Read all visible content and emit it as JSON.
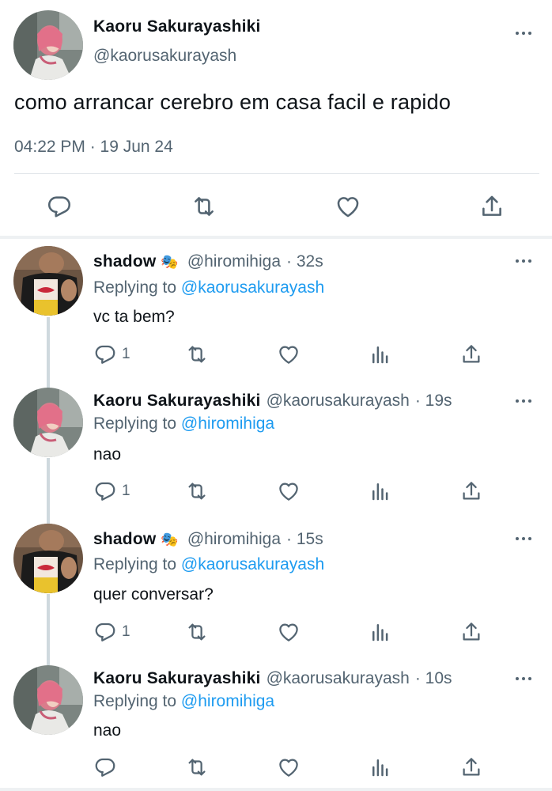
{
  "main_tweet": {
    "author_name": "Kaoru Sakurayashiki",
    "author_handle": "@kaorusakurayash",
    "text": "como arrancar cerebro em casa facil e rapido",
    "timestamp": "04:22 PM · 19 Jun 24",
    "actions": [
      "reply-icon",
      "retweet-icon",
      "like-icon",
      "share-icon"
    ]
  },
  "replies": [
    {
      "name": "shadow",
      "badge": "🎭",
      "handle": "@hiromihiga",
      "time": "· 32s",
      "replying_prefix": "Replying to ",
      "replying_to": "@kaorusakurayash",
      "text": "vc ta bem?",
      "reply_count": "1"
    },
    {
      "name": "Kaoru Sakurayashiki",
      "badge": "",
      "handle": "@kaorusakurayash",
      "time": "· 19s",
      "replying_prefix": "Replying to ",
      "replying_to": "@hiromihiga",
      "text": "nao",
      "reply_count": "1"
    },
    {
      "name": "shadow",
      "badge": "🎭",
      "handle": "@hiromihiga",
      "time": "· 15s",
      "replying_prefix": "Replying to ",
      "replying_to": "@kaorusakurayash",
      "text": "quer conversar?",
      "reply_count": "1"
    },
    {
      "name": "Kaoru Sakurayashiki",
      "badge": "",
      "handle": "@kaorusakurayash",
      "time": "· 10s",
      "replying_prefix": "Replying to ",
      "replying_to": "@hiromihiga",
      "text": "nao",
      "reply_count": ""
    }
  ],
  "colors": {
    "text": "#0f1419",
    "secondary": "#536471",
    "link": "#1d9bf0",
    "divider": "#e1e6ea"
  }
}
